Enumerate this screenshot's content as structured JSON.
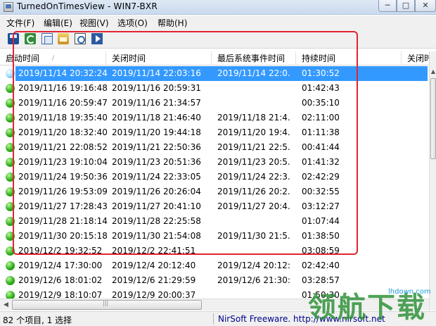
{
  "window": {
    "title": "TurnedOnTimesView  -  WIN7-BXR",
    "minimize": "─",
    "maximize": "□",
    "close": "✕"
  },
  "menu": [
    "文件(F)",
    "编辑(E)",
    "视图(V)",
    "选项(O)",
    "帮助(H)"
  ],
  "toolbar": {
    "icons": [
      "save-icon",
      "refresh-icon",
      "copy-icon",
      "properties-icon",
      "find-icon",
      "exit-icon"
    ]
  },
  "columns": [
    "启动时间",
    "关闭时间",
    "最后系统事件时间",
    "持续时间",
    "关闭时"
  ],
  "sort_indicator": "/",
  "rows": [
    {
      "start": "2019/11/14 20:32:24",
      "end": "2019/11/14 22:03:16",
      "last_event": "2019/11/14 22:0...",
      "duration": "01:30:52",
      "selected": true
    },
    {
      "start": "2019/11/16 19:16:48",
      "end": "2019/11/16 20:59:31",
      "last_event": "",
      "duration": "01:42:43",
      "selected": false
    },
    {
      "start": "2019/11/16 20:59:47",
      "end": "2019/11/16 21:34:57",
      "last_event": "",
      "duration": "00:35:10",
      "selected": false
    },
    {
      "start": "2019/11/18 19:35:40",
      "end": "2019/11/18 21:46:40",
      "last_event": "2019/11/18 21:4...",
      "duration": "02:11:00",
      "selected": false
    },
    {
      "start": "2019/11/20 18:32:40",
      "end": "2019/11/20 19:44:18",
      "last_event": "2019/11/20 19:4...",
      "duration": "01:11:38",
      "selected": false
    },
    {
      "start": "2019/11/21 22:08:52",
      "end": "2019/11/21 22:50:36",
      "last_event": "2019/11/21 22:5...",
      "duration": "00:41:44",
      "selected": false
    },
    {
      "start": "2019/11/23 19:10:04",
      "end": "2019/11/23 20:51:36",
      "last_event": "2019/11/23 20:5...",
      "duration": "01:41:32",
      "selected": false
    },
    {
      "start": "2019/11/24 19:50:36",
      "end": "2019/11/24 22:33:05",
      "last_event": "2019/11/24 22:3...",
      "duration": "02:42:29",
      "selected": false
    },
    {
      "start": "2019/11/26 19:53:09",
      "end": "2019/11/26 20:26:04",
      "last_event": "2019/11/26 20:2...",
      "duration": "00:32:55",
      "selected": false
    },
    {
      "start": "2019/11/27 17:28:43",
      "end": "2019/11/27 20:41:10",
      "last_event": "2019/11/27 20:4...",
      "duration": "03:12:27",
      "selected": false
    },
    {
      "start": "2019/11/28 21:18:14",
      "end": "2019/11/28 22:25:58",
      "last_event": "",
      "duration": "01:07:44",
      "selected": false
    },
    {
      "start": "2019/11/30 20:15:18",
      "end": "2019/11/30 21:54:08",
      "last_event": "2019/11/30 21:5...",
      "duration": "01:38:50",
      "selected": false
    },
    {
      "start": "2019/12/2 19:32:52",
      "end": "2019/12/2 22:41:51",
      "last_event": "",
      "duration": "03:08:59",
      "selected": false
    },
    {
      "start": "2019/12/4 17:30:00",
      "end": "2019/12/4 20:12:40",
      "last_event": "2019/12/4 20:12:...",
      "duration": "02:42:40",
      "selected": false
    },
    {
      "start": "2019/12/6 18:01:02",
      "end": "2019/12/6 21:29:59",
      "last_event": "2019/12/6 21:30:...",
      "duration": "03:28:57",
      "selected": false
    },
    {
      "start": "2019/12/9 18:10:07",
      "end": "2019/12/9 20:00:37",
      "last_event": "",
      "duration": "01:50:30",
      "selected": false
    }
  ],
  "status": {
    "count": "82 个项目, 1 选择",
    "credit": "NirSoft Freeware.  http://www.nirsoft.net"
  },
  "watermark": {
    "text": "领航下载",
    "url": "lhdown.com"
  },
  "colors": {
    "selection": "#3399ff",
    "highlight_box": "#e0242f",
    "watermark": "#2a8f34",
    "status_link": "#00008b"
  }
}
